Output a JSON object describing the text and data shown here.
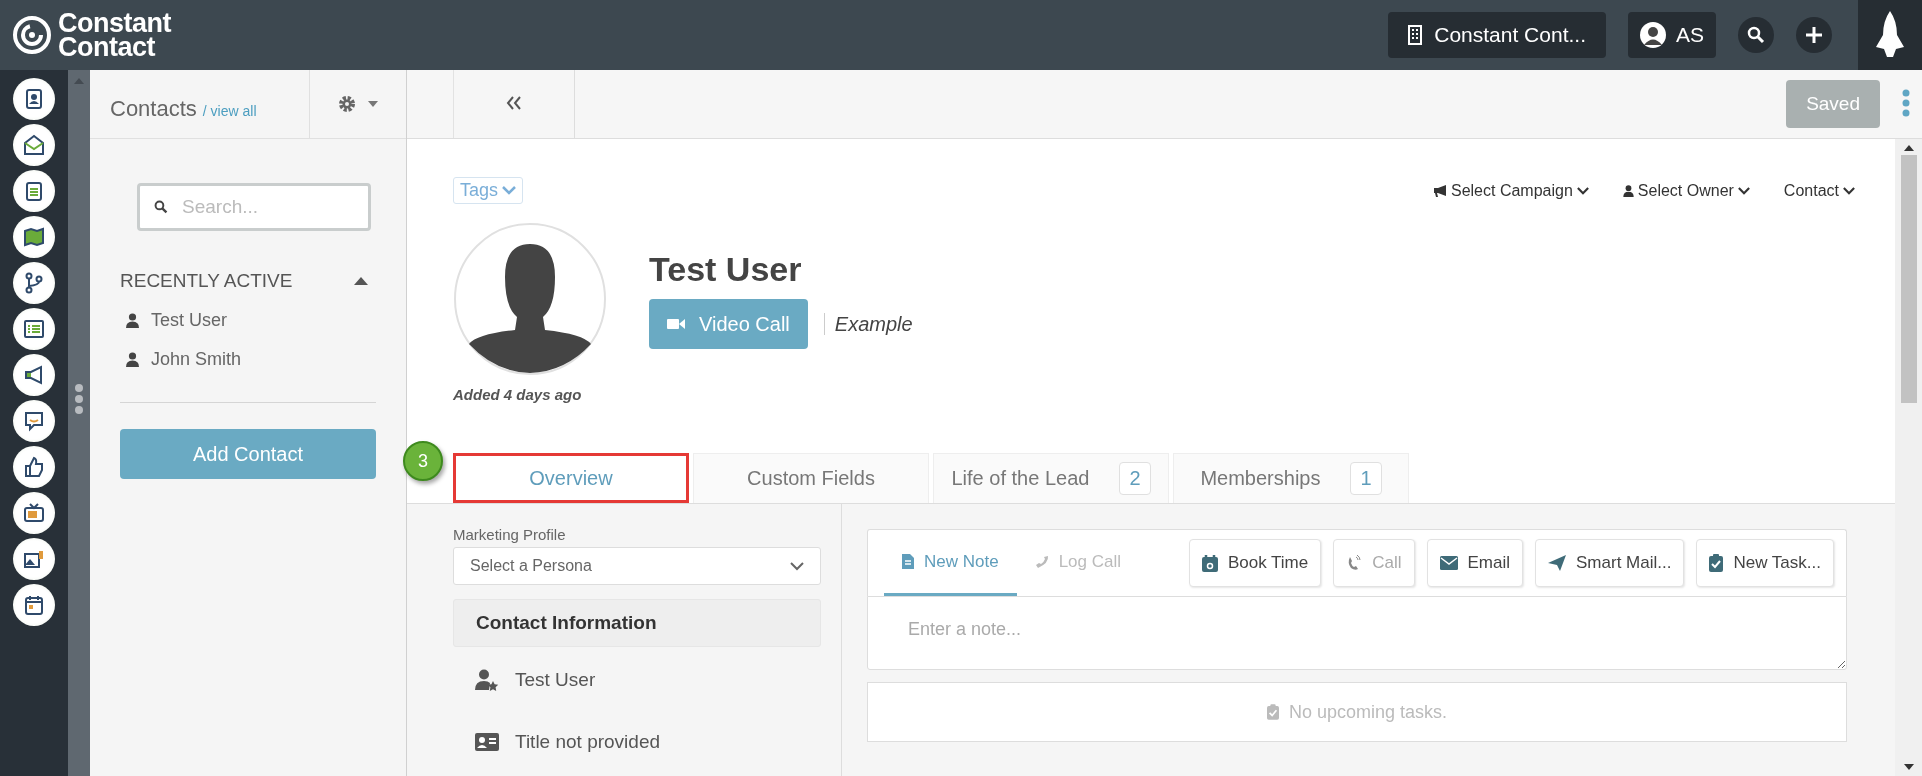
{
  "brand": {
    "line1": "Constant",
    "line2": "Contact"
  },
  "topbar": {
    "account": "Constant Cont...",
    "user_initials": "AS"
  },
  "sidebar": {
    "title": "Contacts",
    "view_all": "/ view all",
    "search": {
      "placeholder": "Search..."
    },
    "section": {
      "title": "RECENTLY ACTIVE",
      "expanded": true
    },
    "recent": [
      {
        "name": "Test User"
      },
      {
        "name": "John Smith"
      }
    ],
    "add_button": "Add Contact"
  },
  "toolbar": {
    "saved_button": "Saved"
  },
  "contact": {
    "tags": "Tags",
    "menus": [
      {
        "kind": "campaign",
        "label": "Select Campaign"
      },
      {
        "kind": "owner",
        "label": "Select Owner"
      },
      {
        "kind": "plain",
        "label": "Contact"
      }
    ],
    "name": "Test User",
    "video_call": "Video Call",
    "company": "Example",
    "added": "Added 4 days ago"
  },
  "annotation": {
    "step": "3"
  },
  "tabs": [
    {
      "label": "Overview",
      "selected": true,
      "highlighted": true
    },
    {
      "label": "Custom Fields",
      "selected": false,
      "highlighted": false
    },
    {
      "label": "Life of the Lead",
      "count": "2",
      "selected": false,
      "highlighted": false
    },
    {
      "label": "Memberships",
      "count": "1",
      "selected": false,
      "highlighted": false
    }
  ],
  "marketing_profile": {
    "label": "Marketing Profile",
    "placeholder": "Select a Persona"
  },
  "contact_information": {
    "title": "Contact Information",
    "rows": [
      {
        "kind": "name",
        "text": "Test User"
      },
      {
        "kind": "title",
        "text": "Title not provided"
      }
    ]
  },
  "activity": {
    "tabs": [
      {
        "kind": "note",
        "label": "New Note",
        "selected": true
      },
      {
        "kind": "call",
        "label": "Log Call",
        "selected": false
      }
    ],
    "actions": [
      {
        "kind": "book",
        "label": "Book Time",
        "disabled": false
      },
      {
        "kind": "call",
        "label": "Call",
        "disabled": true
      },
      {
        "kind": "email",
        "label": "Email",
        "disabled": false
      },
      {
        "kind": "send",
        "label": "Smart Mail...",
        "disabled": false
      },
      {
        "kind": "task",
        "label": "New Task...",
        "disabled": false
      }
    ],
    "note": {
      "placeholder": "Enter a note..."
    },
    "tasks_empty": "No upcoming tasks."
  }
}
